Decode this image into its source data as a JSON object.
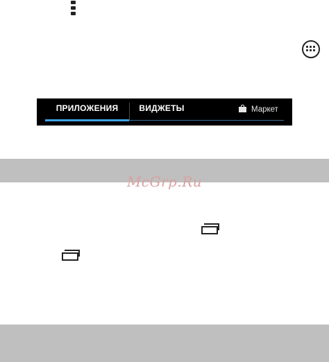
{
  "icons": {
    "overflow_menu": "overflow-menu-icon",
    "all_apps": "all-apps-icon",
    "market_bag": "shopping-bag-icon",
    "recent_apps": "recent-apps-icon"
  },
  "tabs": {
    "apps_label": "ПРИЛОЖЕНИЯ",
    "widgets_label": "ВИДЖЕТЫ",
    "market_label": "Маркет"
  },
  "colors": {
    "tab_bar": "#000000",
    "tab_selected_underline": "#3fa3e6",
    "band": "#bfbfbf",
    "watermark": "#d9a0a0"
  },
  "watermark": "McGrp.Ru"
}
